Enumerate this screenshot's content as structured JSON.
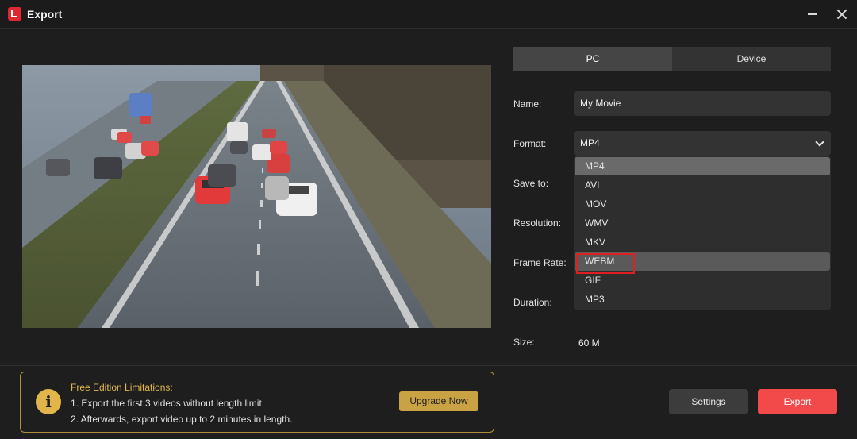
{
  "window": {
    "title": "Export",
    "logo_icon": "app-logo-icon",
    "accent": "#f24a4a"
  },
  "tabs": [
    {
      "label": "PC",
      "active": true
    },
    {
      "label": "Device",
      "active": false
    }
  ],
  "fields": {
    "name_label": "Name:",
    "name_value": "My Movie",
    "format_label": "Format:",
    "format_value": "MP4",
    "save_label": "Save to:",
    "resolution_label": "Resolution:",
    "frame_rate_label": "Frame Rate:",
    "duration_label": "Duration:",
    "size_label": "Size:",
    "size_value": "60 M"
  },
  "format_options": [
    "MP4",
    "AVI",
    "MOV",
    "WMV",
    "MKV",
    "WEBM",
    "GIF",
    "MP3"
  ],
  "format_selected": "MP4",
  "format_highlighted": "WEBM",
  "notice": {
    "title": "Free Edition Limitations:",
    "line1": "1. Export the first 3 videos without length limit.",
    "line2": "2. Afterwards, export video up to 2 minutes in length.",
    "upgrade_label": "Upgrade Now",
    "color": "#e3b84a"
  },
  "buttons": {
    "settings_label": "Settings",
    "export_label": "Export"
  }
}
